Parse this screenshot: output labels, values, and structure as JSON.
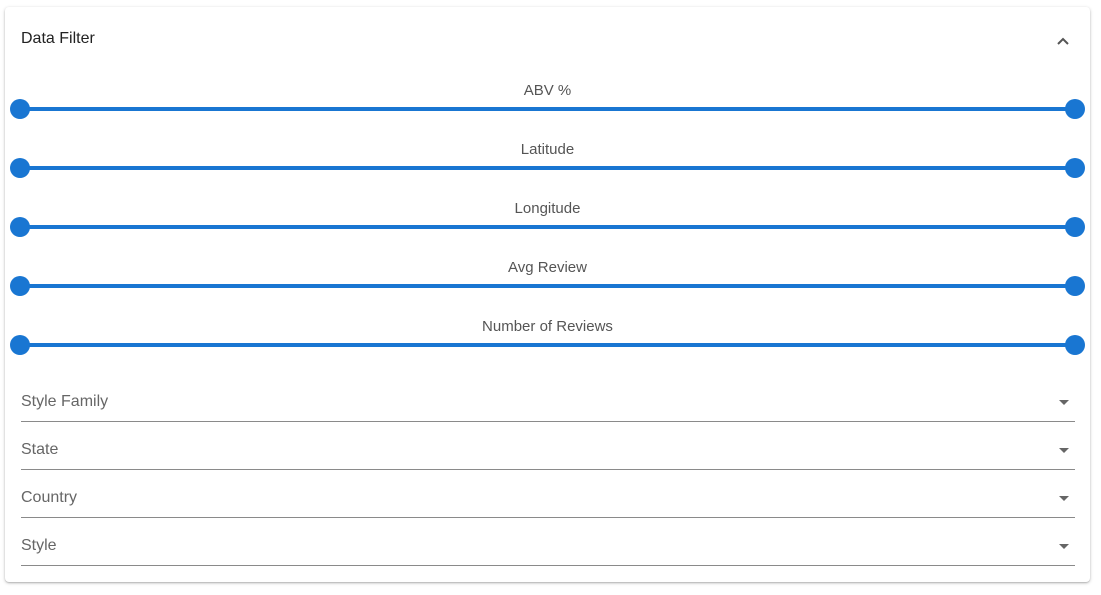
{
  "panel": {
    "title": "Data Filter",
    "collapse_icon": "chevron-up-icon"
  },
  "sliders": [
    {
      "label": "ABV %"
    },
    {
      "label": "Latitude"
    },
    {
      "label": "Longitude"
    },
    {
      "label": "Avg Review"
    },
    {
      "label": "Number of Reviews"
    }
  ],
  "selects": [
    {
      "label": "Style Family"
    },
    {
      "label": "State"
    },
    {
      "label": "Country"
    },
    {
      "label": "Style"
    }
  ],
  "colors": {
    "accent": "#1976d2",
    "label_text": "#555555",
    "underline": "#8a8a8a"
  }
}
